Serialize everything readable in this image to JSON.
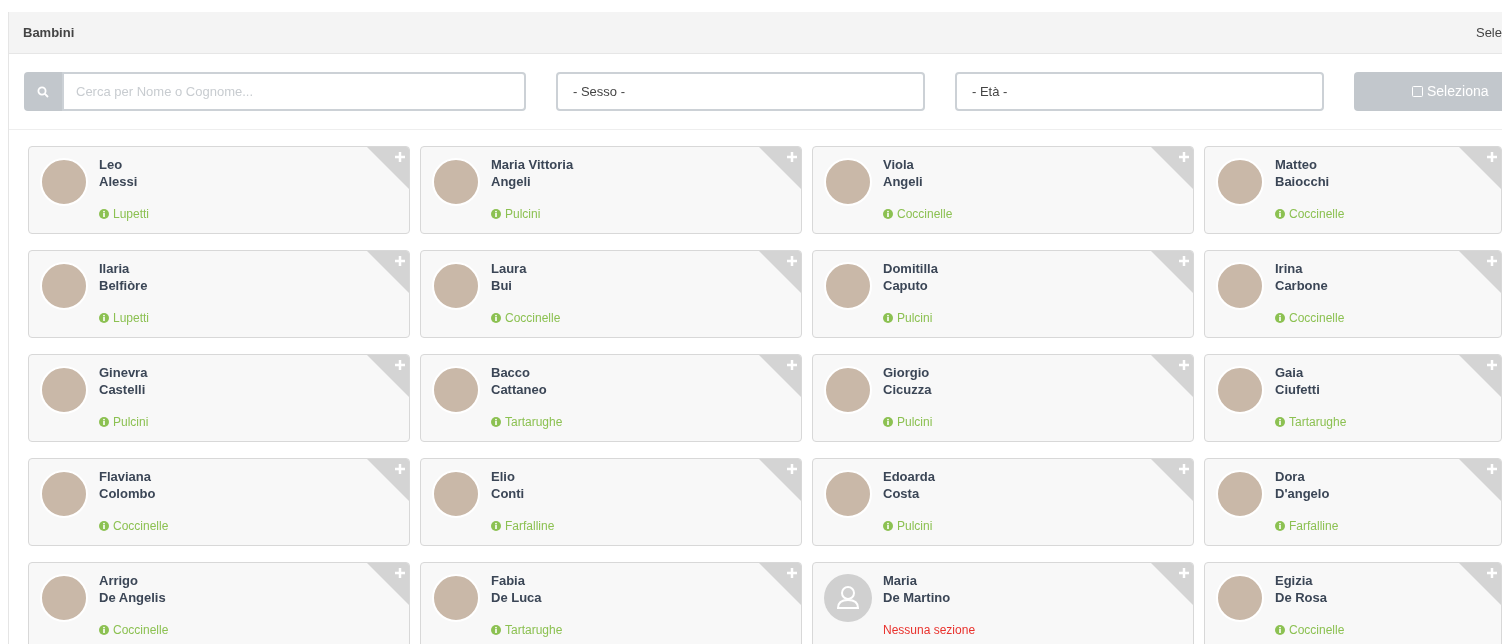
{
  "panel": {
    "title": "Bambini",
    "header_right": "Sele"
  },
  "filters": {
    "search_placeholder": "Cerca per Nome o Cognome...",
    "sex": "- Sesso -",
    "age": "- Età -",
    "select_button": "Seleziona"
  },
  "children": [
    {
      "first": "Leo",
      "last": "Alessi",
      "section": "Lupetti",
      "kind": "section",
      "photo": true
    },
    {
      "first": "Maria Vittoria",
      "last": "Angeli",
      "section": "Pulcini",
      "kind": "section",
      "photo": true
    },
    {
      "first": "Viola",
      "last": "Angeli",
      "section": "Coccinelle",
      "kind": "section",
      "photo": true
    },
    {
      "first": "Matteo",
      "last": "Baiocchi",
      "section": "Coccinelle",
      "kind": "section",
      "photo": true
    },
    {
      "first": "Ilaria",
      "last": "Belfiòre",
      "section": "Lupetti",
      "kind": "section",
      "photo": true
    },
    {
      "first": "Laura",
      "last": "Bui",
      "section": "Coccinelle",
      "kind": "section",
      "photo": true
    },
    {
      "first": "Domitilla",
      "last": "Caputo",
      "section": "Pulcini",
      "kind": "section",
      "photo": true
    },
    {
      "first": "Irina",
      "last": "Carbone",
      "section": "Coccinelle",
      "kind": "section",
      "photo": true
    },
    {
      "first": "Ginevra",
      "last": "Castelli",
      "section": "Pulcini",
      "kind": "section",
      "photo": true
    },
    {
      "first": "Bacco",
      "last": "Cattaneo",
      "section": "Tartarughe",
      "kind": "section",
      "photo": true
    },
    {
      "first": "Giorgio",
      "last": "Cicuzza",
      "section": "Pulcini",
      "kind": "section",
      "photo": true
    },
    {
      "first": "Gaia",
      "last": "Ciufetti",
      "section": "Tartarughe",
      "kind": "section",
      "photo": true
    },
    {
      "first": "Flaviana",
      "last": "Colombo",
      "section": "Coccinelle",
      "kind": "section",
      "photo": true
    },
    {
      "first": "Elio",
      "last": "Conti",
      "section": "Farfalline",
      "kind": "section",
      "photo": true
    },
    {
      "first": "Edoarda",
      "last": "Costa",
      "section": "Pulcini",
      "kind": "section",
      "photo": true
    },
    {
      "first": "Dora",
      "last": "D'angelo",
      "section": "Farfalline",
      "kind": "section",
      "photo": true
    },
    {
      "first": "Arrigo",
      "last": "De Angelis",
      "section": "Coccinelle",
      "kind": "section",
      "photo": true
    },
    {
      "first": "Fabia",
      "last": "De Luca",
      "section": "Tartarughe",
      "kind": "section",
      "photo": true
    },
    {
      "first": "Maria",
      "last": "De Martino",
      "section": "Nessuna sezione",
      "kind": "none",
      "photo": false
    },
    {
      "first": "Egizia",
      "last": "De Rosa",
      "section": "Coccinelle",
      "kind": "section",
      "photo": true
    }
  ]
}
